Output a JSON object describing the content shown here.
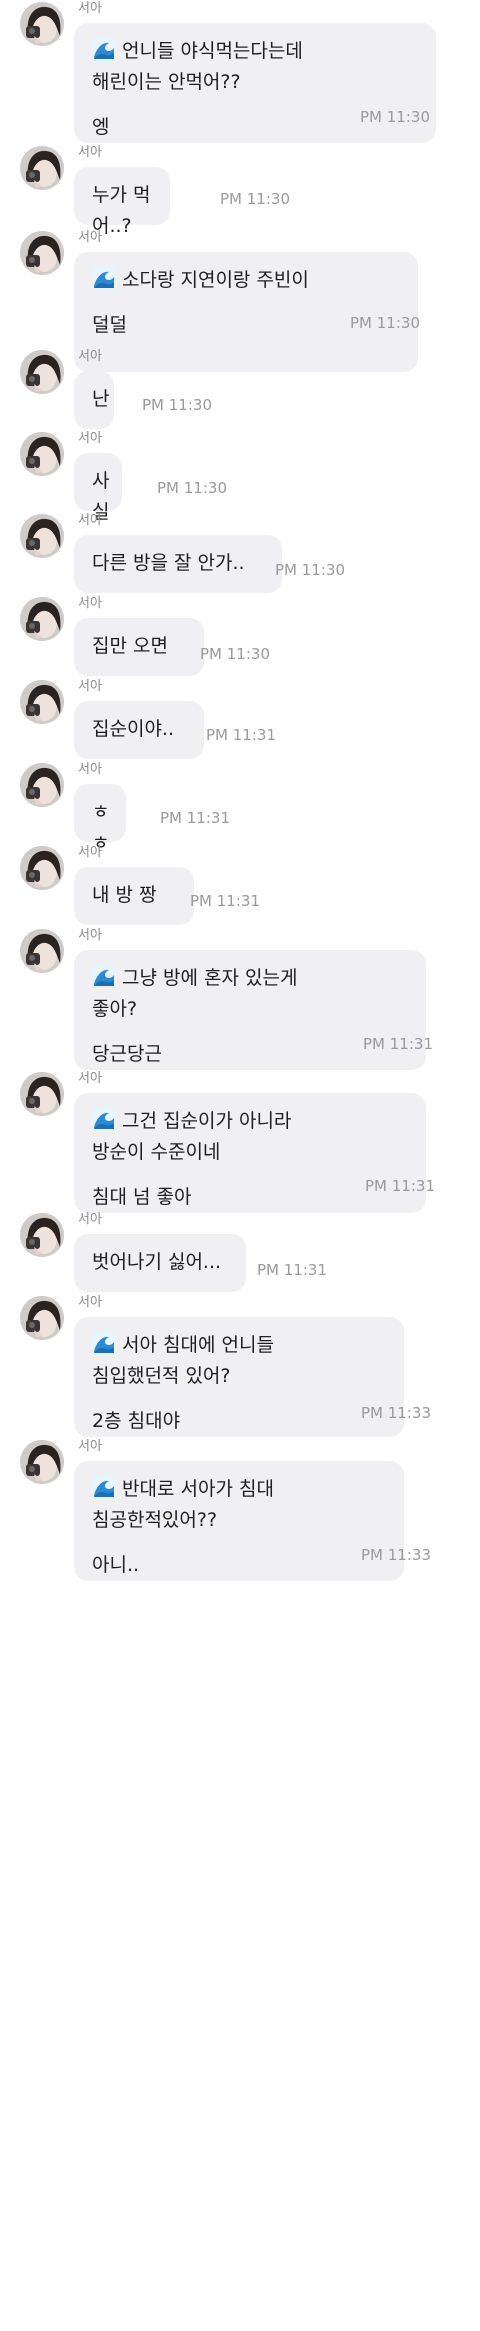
{
  "sender_name": "서아",
  "messages": [
    {
      "quote_icon": "wave-emoji-icon",
      "quote": "언니들 야식먹는다는데\n해린이는 안먹어??",
      "reply": "엥",
      "time": "PM 11:30"
    },
    {
      "reply": "누가 먹어..?",
      "time": "PM 11:30"
    },
    {
      "quote_icon": "wave-emoji-icon",
      "quote": "소다랑 지연이랑 주빈이",
      "reply": "덜덜",
      "time": "PM 11:30"
    },
    {
      "reply": "난",
      "time": "PM 11:30"
    },
    {
      "reply": "사실",
      "time": "PM 11:30"
    },
    {
      "reply": "다른 방을 잘 안가..",
      "time": "PM 11:30"
    },
    {
      "reply": "집만 오면",
      "time": "PM 11:30"
    },
    {
      "reply": "집순이야..",
      "time": "PM 11:31"
    },
    {
      "reply": "ㅎㅎ",
      "time": "PM 11:31"
    },
    {
      "reply": "내 방 짱",
      "time": "PM 11:31"
    },
    {
      "quote_icon": "wave-emoji-icon",
      "quote": "그냥 방에 혼자 있는게\n좋아?",
      "reply": "당근당근",
      "time": "PM 11:31"
    },
    {
      "quote_icon": "wave-emoji-icon",
      "quote": "그건 집순이가 아니라\n방순이 수준이네",
      "reply": "침대 넘 좋아",
      "time": "PM 11:31"
    },
    {
      "reply": "벗어나기 싫어...",
      "time": "PM 11:31"
    },
    {
      "quote_icon": "wave-emoji-icon",
      "quote": "서아 침대에 언니들\n침입했던적 있어?",
      "reply": "2층 침대야",
      "time": "PM 11:33"
    },
    {
      "quote_icon": "wave-emoji-icon",
      "quote": "반대로 서아가 침대\n침공한적있어??",
      "reply": "아니..",
      "time": "PM 11:33"
    }
  ]
}
